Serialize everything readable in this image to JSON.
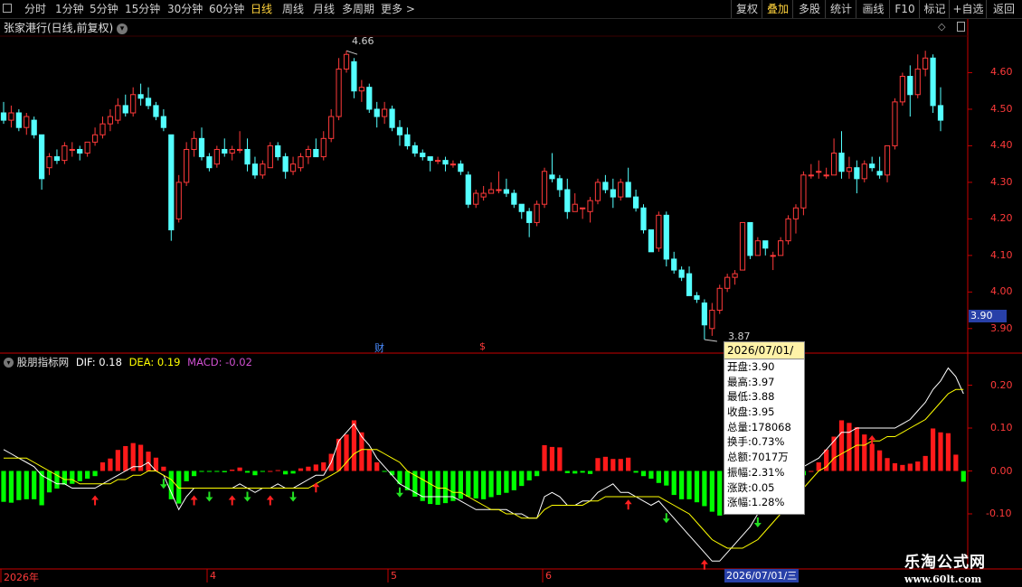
{
  "toolbar": {
    "periods": [
      "分时",
      "1分钟",
      "5分钟",
      "15分钟",
      "30分钟",
      "60分钟",
      "日线",
      "周线",
      "月线",
      "多周期",
      "更多 >"
    ],
    "active_period": "日线",
    "right_buttons": [
      "复权",
      "叠加",
      "多股",
      "统计",
      "画线",
      "F10",
      "标记",
      "+自选",
      "返回"
    ],
    "active_right": "叠加"
  },
  "main_chart": {
    "title": "张家港行(日线,前复权)",
    "price_labels": [
      "4.60",
      "4.50",
      "4.40",
      "4.30",
      "4.20",
      "4.10",
      "4.00",
      "3.90"
    ],
    "high_marker": "4.66",
    "low_marker": "3.87",
    "current_price_tag": "3.90",
    "event_markers": [
      "财",
      "$"
    ]
  },
  "indicator": {
    "name": "股朋指标网",
    "dif_label": "DIF: 0.18",
    "dea_label": "DEA: 0.19",
    "macd_label": "MACD: -0.02",
    "axis_labels": [
      "0.20",
      "0.10",
      "0.00",
      "-0.10"
    ]
  },
  "date_axis": {
    "labels": [
      "2026年",
      "4",
      "5",
      "6"
    ],
    "cursor_date": "2026/07/01/三"
  },
  "tooltip": {
    "date": "2026/07/01/三",
    "rows": [
      "开盘:3.90",
      "最高:3.97",
      "最低:3.88",
      "收盘:3.95",
      "总量:178068",
      "换手:0.73%",
      "总额:7017万",
      "振幅:2.31%",
      "涨跌:0.05",
      "涨幅:1.28%"
    ]
  },
  "watermark": {
    "title": "乐淘公式网",
    "url": "www.60lt.com"
  },
  "colors": {
    "up": "#ff3a3a",
    "down": "#54ffff",
    "macd_up": "#ff1a1a",
    "macd_down": "#00ff00",
    "dif_line": "#ffffff",
    "dea_line": "#ffff00",
    "axis": "#c80000",
    "label_red": "#ff3a3a"
  },
  "chart_data": {
    "type": "candlestick",
    "price_range": [
      3.86,
      4.7
    ],
    "candles": [
      [
        4.49,
        4.52,
        4.46,
        4.47
      ],
      [
        4.47,
        4.51,
        4.45,
        4.49
      ],
      [
        4.49,
        4.5,
        4.44,
        4.45
      ],
      [
        4.45,
        4.49,
        4.43,
        4.48
      ],
      [
        4.47,
        4.48,
        4.42,
        4.43
      ],
      [
        4.43,
        4.43,
        4.28,
        4.31
      ],
      [
        4.34,
        4.38,
        4.32,
        4.37
      ],
      [
        4.37,
        4.39,
        4.35,
        4.36
      ],
      [
        4.36,
        4.41,
        4.35,
        4.4
      ],
      [
        4.39,
        4.41,
        4.37,
        4.39
      ],
      [
        4.39,
        4.4,
        4.36,
        4.38
      ],
      [
        4.38,
        4.41,
        4.37,
        4.41
      ],
      [
        4.41,
        4.45,
        4.4,
        4.43
      ],
      [
        4.43,
        4.48,
        4.42,
        4.46
      ],
      [
        4.46,
        4.5,
        4.44,
        4.48
      ],
      [
        4.47,
        4.53,
        4.46,
        4.51
      ],
      [
        4.51,
        4.54,
        4.48,
        4.49
      ],
      [
        4.49,
        4.56,
        4.48,
        4.54
      ],
      [
        4.54,
        4.57,
        4.51,
        4.53
      ],
      [
        4.53,
        4.56,
        4.5,
        4.51
      ],
      [
        4.51,
        4.52,
        4.47,
        4.48
      ],
      [
        4.48,
        4.5,
        4.44,
        4.45
      ],
      [
        4.43,
        4.43,
        4.14,
        4.17
      ],
      [
        4.2,
        4.32,
        4.19,
        4.3
      ],
      [
        4.3,
        4.41,
        4.29,
        4.39
      ],
      [
        4.39,
        4.44,
        4.37,
        4.42
      ],
      [
        4.42,
        4.45,
        4.36,
        4.37
      ],
      [
        4.37,
        4.38,
        4.33,
        4.34
      ],
      [
        4.35,
        4.4,
        4.34,
        4.39
      ],
      [
        4.39,
        4.42,
        4.37,
        4.38
      ],
      [
        4.38,
        4.4,
        4.36,
        4.39
      ],
      [
        4.39,
        4.44,
        4.38,
        4.39
      ],
      [
        4.39,
        4.42,
        4.33,
        4.35
      ],
      [
        4.35,
        4.37,
        4.31,
        4.32
      ],
      [
        4.32,
        4.36,
        4.31,
        4.35
      ],
      [
        4.34,
        4.41,
        4.34,
        4.4
      ],
      [
        4.4,
        4.41,
        4.36,
        4.37
      ],
      [
        4.37,
        4.38,
        4.31,
        4.33
      ],
      [
        4.33,
        4.37,
        4.32,
        4.35
      ],
      [
        4.34,
        4.38,
        4.33,
        4.37
      ],
      [
        4.37,
        4.4,
        4.35,
        4.39
      ],
      [
        4.39,
        4.42,
        4.37,
        4.37
      ],
      [
        4.37,
        4.44,
        4.36,
        4.42
      ],
      [
        4.42,
        4.5,
        4.41,
        4.48
      ],
      [
        4.48,
        4.64,
        4.47,
        4.61
      ],
      [
        4.61,
        4.66,
        4.6,
        4.65
      ],
      [
        4.63,
        4.64,
        4.53,
        4.55
      ],
      [
        4.55,
        4.58,
        4.52,
        4.56
      ],
      [
        4.56,
        4.57,
        4.49,
        4.5
      ],
      [
        4.5,
        4.52,
        4.45,
        4.48
      ],
      [
        4.48,
        4.52,
        4.46,
        4.5
      ],
      [
        4.5,
        4.51,
        4.44,
        4.45
      ],
      [
        4.45,
        4.47,
        4.4,
        4.43
      ],
      [
        4.43,
        4.45,
        4.39,
        4.4
      ],
      [
        4.4,
        4.41,
        4.37,
        4.38
      ],
      [
        4.38,
        4.39,
        4.36,
        4.37
      ],
      [
        4.37,
        4.37,
        4.33,
        4.36
      ],
      [
        4.36,
        4.37,
        4.35,
        4.36
      ],
      [
        4.36,
        4.37,
        4.33,
        4.35
      ],
      [
        4.35,
        4.36,
        4.34,
        4.35
      ],
      [
        4.35,
        4.36,
        4.32,
        4.33
      ],
      [
        4.32,
        4.33,
        4.23,
        4.24
      ],
      [
        4.24,
        4.28,
        4.23,
        4.27
      ],
      [
        4.26,
        4.29,
        4.25,
        4.27
      ],
      [
        4.27,
        4.3,
        4.27,
        4.28
      ],
      [
        4.28,
        4.33,
        4.27,
        4.28
      ],
      [
        4.28,
        4.31,
        4.26,
        4.27
      ],
      [
        4.27,
        4.28,
        4.23,
        4.24
      ],
      [
        4.24,
        4.24,
        4.2,
        4.22
      ],
      [
        4.22,
        4.23,
        4.15,
        4.19
      ],
      [
        4.19,
        4.25,
        4.18,
        4.24
      ],
      [
        4.24,
        4.34,
        4.23,
        4.33
      ],
      [
        4.32,
        4.38,
        4.3,
        4.31
      ],
      [
        4.31,
        4.32,
        4.26,
        4.28
      ],
      [
        4.28,
        4.31,
        4.2,
        4.22
      ],
      [
        4.22,
        4.27,
        4.22,
        4.24
      ],
      [
        4.23,
        4.23,
        4.2,
        4.23
      ],
      [
        4.22,
        4.26,
        4.19,
        4.25
      ],
      [
        4.25,
        4.31,
        4.24,
        4.3
      ],
      [
        4.3,
        4.32,
        4.27,
        4.28
      ],
      [
        4.28,
        4.31,
        4.23,
        4.26
      ],
      [
        4.26,
        4.31,
        4.25,
        4.3
      ],
      [
        4.3,
        4.34,
        4.26,
        4.26
      ],
      [
        4.26,
        4.28,
        4.22,
        4.23
      ],
      [
        4.23,
        4.24,
        4.16,
        4.17
      ],
      [
        4.17,
        4.17,
        4.11,
        4.11
      ],
      [
        4.12,
        4.22,
        4.11,
        4.21
      ],
      [
        4.21,
        4.22,
        4.07,
        4.09
      ],
      [
        4.09,
        4.11,
        4.05,
        4.06
      ],
      [
        4.06,
        4.07,
        4.03,
        4.04
      ],
      [
        4.05,
        4.07,
        3.99,
        3.99
      ],
      [
        3.99,
        4.0,
        3.97,
        3.98
      ],
      [
        3.97,
        3.98,
        3.87,
        3.91
      ],
      [
        3.9,
        3.97,
        3.88,
        3.95
      ],
      [
        3.95,
        4.02,
        3.94,
        4.01
      ],
      [
        4.01,
        4.05,
        4.0,
        4.04
      ],
      [
        4.04,
        4.06,
        4.02,
        4.05
      ],
      [
        4.06,
        4.19,
        4.06,
        4.19
      ],
      [
        4.19,
        4.19,
        4.09,
        4.1
      ],
      [
        4.1,
        4.15,
        4.1,
        4.14
      ],
      [
        4.14,
        4.14,
        4.1,
        4.12
      ],
      [
        4.1,
        4.11,
        4.06,
        4.1
      ],
      [
        4.1,
        4.15,
        4.1,
        4.14
      ],
      [
        4.14,
        4.21,
        4.13,
        4.2
      ],
      [
        4.2,
        4.24,
        4.16,
        4.23
      ],
      [
        4.23,
        4.33,
        4.21,
        4.32
      ],
      [
        4.32,
        4.35,
        4.31,
        4.32
      ],
      [
        4.33,
        4.36,
        4.31,
        4.33
      ],
      [
        4.32,
        4.34,
        4.31,
        4.32
      ],
      [
        4.32,
        4.42,
        4.32,
        4.38
      ],
      [
        4.38,
        4.44,
        4.31,
        4.33
      ],
      [
        4.33,
        4.37,
        4.31,
        4.34
      ],
      [
        4.34,
        4.36,
        4.27,
        4.31
      ],
      [
        4.31,
        4.36,
        4.3,
        4.35
      ],
      [
        4.35,
        4.37,
        4.33,
        4.34
      ],
      [
        4.33,
        4.37,
        4.31,
        4.32
      ],
      [
        4.32,
        4.4,
        4.3,
        4.4
      ],
      [
        4.4,
        4.53,
        4.39,
        4.52
      ],
      [
        4.52,
        4.6,
        4.51,
        4.59
      ],
      [
        4.59,
        4.62,
        4.48,
        4.54
      ],
      [
        4.54,
        4.65,
        4.53,
        4.61
      ],
      [
        4.61,
        4.66,
        4.59,
        4.64
      ],
      [
        4.64,
        4.65,
        4.49,
        4.51
      ],
      [
        4.51,
        4.56,
        4.44,
        4.47
      ]
    ],
    "macd_values": [
      -0.072,
      -0.074,
      -0.068,
      -0.066,
      -0.066,
      -0.08,
      -0.05,
      -0.041,
      -0.032,
      -0.03,
      -0.024,
      -0.018,
      -0.012,
      0.02,
      0.029,
      0.049,
      0.058,
      0.065,
      0.061,
      0.045,
      0.031,
      0.01,
      -0.066,
      -0.076,
      -0.024,
      -0.012,
      -0.002,
      -0.001,
      -0.001,
      -0.003,
      0.003,
      0.008,
      -0.004,
      -0.01,
      -0.001,
      0.0,
      0.002,
      -0.008,
      -0.006,
      0.006,
      0.01,
      0.015,
      0.02,
      0.04,
      0.075,
      0.085,
      0.118,
      0.09,
      0.05,
      0.02,
      -0.002,
      -0.01,
      -0.03,
      -0.045,
      -0.06,
      -0.07,
      -0.077,
      -0.079,
      -0.075,
      -0.07,
      -0.065,
      -0.06,
      -0.064,
      -0.066,
      -0.061,
      -0.056,
      -0.051,
      -0.045,
      -0.035,
      -0.022,
      -0.012,
      0.06,
      0.056,
      0.055,
      -0.005,
      -0.006,
      -0.004,
      -0.007,
      0.03,
      0.033,
      0.028,
      0.028,
      0.031,
      -0.004,
      -0.012,
      -0.018,
      -0.028,
      -0.034,
      -0.056,
      -0.066,
      -0.066,
      -0.073,
      -0.082,
      -0.095,
      -0.104,
      -0.098,
      -0.09,
      -0.085,
      -0.075,
      -0.065,
      -0.06,
      -0.052,
      -0.04,
      -0.03,
      -0.02,
      -0.01,
      0.0,
      0.02,
      0.05,
      0.08,
      0.118,
      0.112,
      0.102,
      0.085,
      0.063,
      0.048,
      0.03,
      0.018,
      0.014,
      0.017,
      0.022,
      0.035,
      0.099,
      0.09,
      0.088,
      0.038,
      -0.025
    ],
    "dif": [
      0.05,
      0.04,
      0.03,
      0.02,
      0.01,
      -0.01,
      -0.02,
      -0.03,
      -0.03,
      -0.04,
      -0.04,
      -0.04,
      -0.04,
      -0.03,
      -0.02,
      -0.01,
      0.0,
      0.01,
      0.01,
      0.02,
      0.0,
      -0.01,
      -0.05,
      -0.09,
      -0.06,
      -0.04,
      -0.04,
      -0.04,
      -0.04,
      -0.04,
      -0.04,
      -0.03,
      -0.04,
      -0.05,
      -0.04,
      -0.04,
      -0.03,
      -0.04,
      -0.04,
      -0.03,
      -0.02,
      -0.01,
      -0.01,
      0.02,
      0.07,
      0.09,
      0.11,
      0.08,
      0.06,
      0.03,
      0.01,
      -0.01,
      -0.03,
      -0.04,
      -0.05,
      -0.06,
      -0.06,
      -0.06,
      -0.06,
      -0.06,
      -0.07,
      -0.08,
      -0.09,
      -0.09,
      -0.09,
      -0.09,
      -0.09,
      -0.1,
      -0.1,
      -0.11,
      -0.11,
      -0.06,
      -0.05,
      -0.06,
      -0.08,
      -0.08,
      -0.07,
      -0.07,
      -0.05,
      -0.04,
      -0.03,
      -0.05,
      -0.05,
      -0.06,
      -0.07,
      -0.08,
      -0.07,
      -0.09,
      -0.11,
      -0.13,
      -0.15,
      -0.17,
      -0.19,
      -0.21,
      -0.21,
      -0.19,
      -0.17,
      -0.15,
      -0.13,
      -0.1,
      -0.08,
      -0.06,
      -0.04,
      -0.02,
      0.0,
      0.01,
      0.02,
      0.03,
      0.05,
      0.07,
      0.09,
      0.09,
      0.1,
      0.1,
      0.1,
      0.1,
      0.1,
      0.1,
      0.11,
      0.12,
      0.14,
      0.16,
      0.19,
      0.21,
      0.24,
      0.22,
      0.18
    ],
    "dea": [
      0.03,
      0.03,
      0.03,
      0.03,
      0.02,
      0.01,
      0.0,
      -0.01,
      -0.02,
      -0.02,
      -0.03,
      -0.03,
      -0.03,
      -0.03,
      -0.03,
      -0.02,
      -0.02,
      -0.01,
      -0.01,
      0.0,
      0.0,
      -0.01,
      -0.02,
      -0.04,
      -0.04,
      -0.04,
      -0.04,
      -0.04,
      -0.04,
      -0.04,
      -0.04,
      -0.04,
      -0.04,
      -0.04,
      -0.04,
      -0.04,
      -0.04,
      -0.04,
      -0.04,
      -0.04,
      -0.04,
      -0.03,
      -0.02,
      -0.01,
      0.0,
      0.02,
      0.04,
      0.05,
      0.05,
      0.05,
      0.04,
      0.03,
      0.02,
      0.0,
      -0.01,
      -0.02,
      -0.03,
      -0.04,
      -0.04,
      -0.05,
      -0.05,
      -0.06,
      -0.07,
      -0.08,
      -0.09,
      -0.09,
      -0.1,
      -0.1,
      -0.11,
      -0.11,
      -0.11,
      -0.09,
      -0.08,
      -0.08,
      -0.08,
      -0.08,
      -0.08,
      -0.07,
      -0.07,
      -0.06,
      -0.06,
      -0.06,
      -0.06,
      -0.06,
      -0.06,
      -0.06,
      -0.06,
      -0.07,
      -0.08,
      -0.09,
      -0.1,
      -0.12,
      -0.14,
      -0.16,
      -0.17,
      -0.18,
      -0.18,
      -0.18,
      -0.17,
      -0.16,
      -0.14,
      -0.12,
      -0.1,
      -0.08,
      -0.06,
      -0.04,
      -0.02,
      0.0,
      0.01,
      0.03,
      0.04,
      0.05,
      0.06,
      0.06,
      0.07,
      0.07,
      0.08,
      0.08,
      0.09,
      0.1,
      0.11,
      0.12,
      0.14,
      0.16,
      0.18,
      0.19,
      0.19
    ],
    "signals": [
      {
        "i": 12,
        "dir": "up"
      },
      {
        "i": 21,
        "dir": "down"
      },
      {
        "i": 25,
        "dir": "up"
      },
      {
        "i": 27,
        "dir": "down"
      },
      {
        "i": 30,
        "dir": "up"
      },
      {
        "i": 32,
        "dir": "down"
      },
      {
        "i": 35,
        "dir": "up"
      },
      {
        "i": 38,
        "dir": "down"
      },
      {
        "i": 41,
        "dir": "up"
      },
      {
        "i": 52,
        "dir": "down"
      },
      {
        "i": 82,
        "dir": "up"
      },
      {
        "i": 87,
        "dir": "down"
      },
      {
        "i": 92,
        "dir": "up"
      },
      {
        "i": 99,
        "dir": "down"
      },
      {
        "i": 114,
        "dir": "up"
      },
      {
        "i": 140,
        "dir": "down"
      }
    ]
  }
}
